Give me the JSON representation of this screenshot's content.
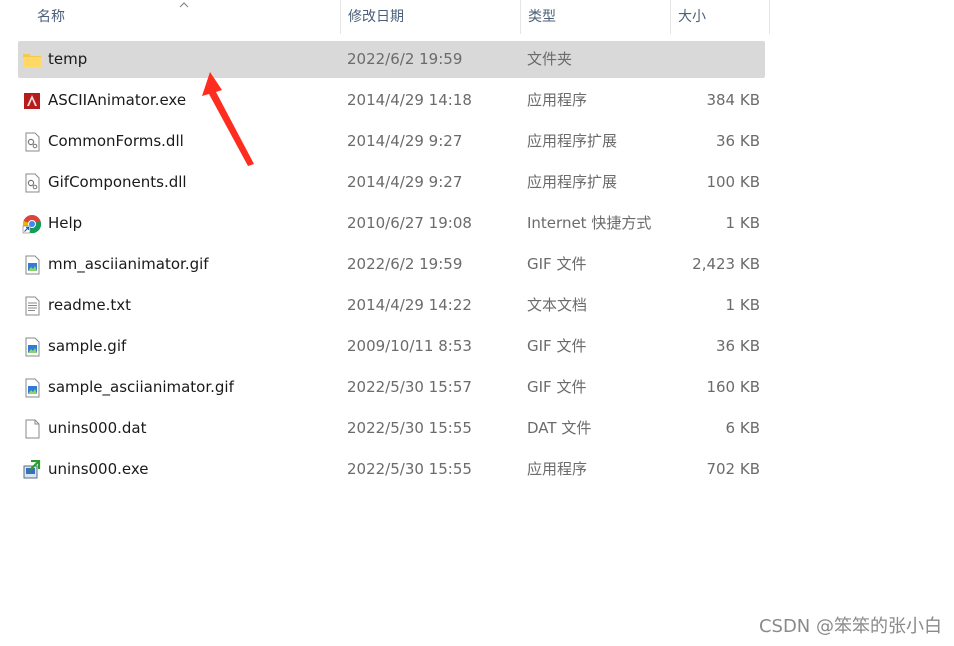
{
  "columns": {
    "name": "名称",
    "date": "修改日期",
    "type": "类型",
    "size": "大小"
  },
  "files": [
    {
      "name": "temp",
      "date": "2022/6/2 19:59",
      "type": "文件夹",
      "size": "",
      "icon": "folder-icon",
      "selected": true
    },
    {
      "name": "ASCIIAnimator.exe",
      "date": "2014/4/29 14:18",
      "type": "应用程序",
      "size": "384 KB",
      "icon": "app-icon"
    },
    {
      "name": "CommonForms.dll",
      "date": "2014/4/29 9:27",
      "type": "应用程序扩展",
      "size": "36 KB",
      "icon": "dll-icon"
    },
    {
      "name": "GifComponents.dll",
      "date": "2014/4/29 9:27",
      "type": "应用程序扩展",
      "size": "100 KB",
      "icon": "dll-icon"
    },
    {
      "name": "Help",
      "date": "2010/6/27 19:08",
      "type": "Internet 快捷方式",
      "size": "1 KB",
      "icon": "chrome-shortcut-icon"
    },
    {
      "name": "mm_asciianimator.gif",
      "date": "2022/6/2 19:59",
      "type": "GIF 文件",
      "size": "2,423 KB",
      "icon": "image-file-icon"
    },
    {
      "name": "readme.txt",
      "date": "2014/4/29 14:22",
      "type": "文本文档",
      "size": "1 KB",
      "icon": "text-file-icon"
    },
    {
      "name": "sample.gif",
      "date": "2009/10/11 8:53",
      "type": "GIF 文件",
      "size": "36 KB",
      "icon": "image-file-icon"
    },
    {
      "name": "sample_asciianimator.gif",
      "date": "2022/5/30 15:57",
      "type": "GIF 文件",
      "size": "160 KB",
      "icon": "image-file-icon"
    },
    {
      "name": "unins000.dat",
      "date": "2022/5/30 15:55",
      "type": "DAT 文件",
      "size": "6 KB",
      "icon": "blank-file-icon"
    },
    {
      "name": "unins000.exe",
      "date": "2022/5/30 15:55",
      "type": "应用程序",
      "size": "702 KB",
      "icon": "installer-icon"
    }
  ],
  "watermark": "CSDN @笨笨的张小白",
  "colors": {
    "selection": "#d9d9d9",
    "annotation_arrow": "#ff2d20",
    "header_text": "#4c607a"
  }
}
